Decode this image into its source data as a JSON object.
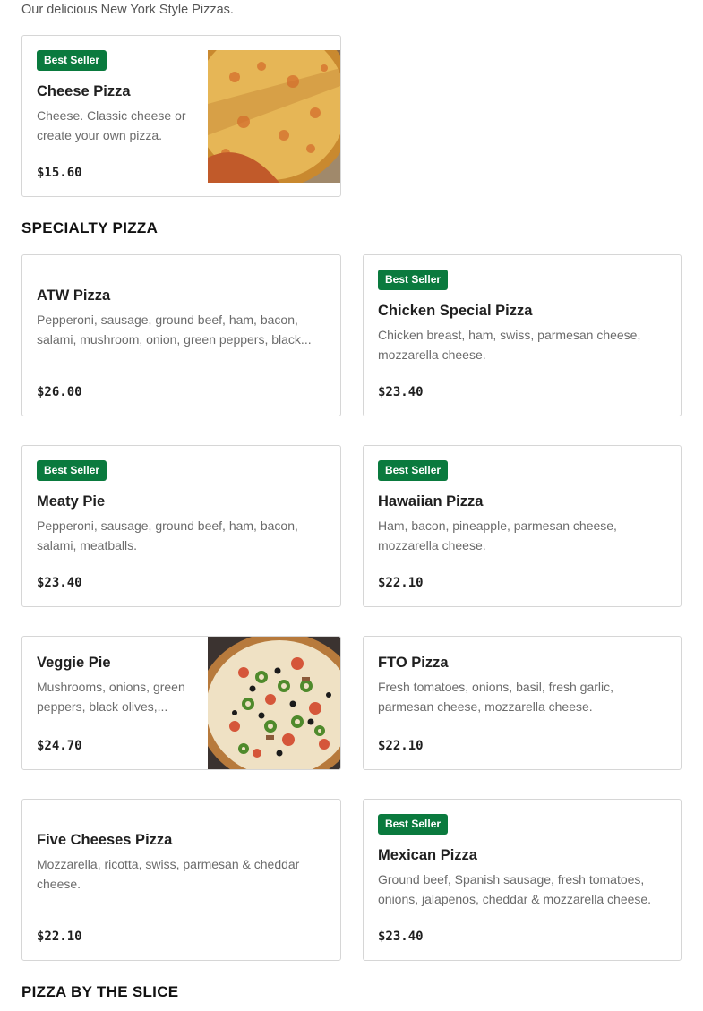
{
  "intro": "Our delicious New York Style Pizzas.",
  "featured": {
    "badge": "Best Seller",
    "name": "Cheese Pizza",
    "desc": "Cheese. Classic cheese or create your own pizza.",
    "price": "$15.60"
  },
  "specialty_title": "SPECIALTY PIZZA",
  "items": [
    {
      "name": "ATW Pizza",
      "badge": "",
      "desc": "Pepperoni, sausage, ground beef, ham, bacon, salami, mushroom, onion, green peppers, black...",
      "price": "$26.00"
    },
    {
      "name": "Chicken Special Pizza",
      "badge": "Best Seller",
      "desc": "Chicken breast, ham, swiss, parmesan cheese, mozzarella cheese.",
      "price": "$23.40"
    },
    {
      "name": "Meaty Pie",
      "badge": "Best Seller",
      "desc": "Pepperoni, sausage, ground beef, ham, bacon, salami, meatballs.",
      "price": "$23.40"
    },
    {
      "name": "Hawaiian Pizza",
      "badge": "Best Seller",
      "desc": "Ham, bacon, pineapple, parmesan cheese, mozzarella cheese.",
      "price": "$22.10"
    },
    {
      "name": "Veggie Pie",
      "badge": "",
      "desc": "Mushrooms, onions, green peppers, black olives,...",
      "price": "$24.70"
    },
    {
      "name": "FTO Pizza",
      "badge": "",
      "desc": "Fresh tomatoes, onions, basil, fresh garlic, parmesan cheese, mozzarella cheese.",
      "price": "$22.10"
    },
    {
      "name": "Five Cheeses Pizza",
      "badge": "",
      "desc": "Mozzarella, ricotta, swiss, parmesan & cheddar cheese.",
      "price": "$22.10"
    },
    {
      "name": "Mexican Pizza",
      "badge": "Best Seller",
      "desc": "Ground beef, Spanish sausage, fresh tomatoes, onions, jalapenos, cheddar & mozzarella cheese.",
      "price": "$23.40"
    }
  ],
  "slice_title": "PIZZA BY THE SLICE",
  "colors": {
    "badge": "#0a7a3e",
    "border": "#d6d6d6"
  }
}
